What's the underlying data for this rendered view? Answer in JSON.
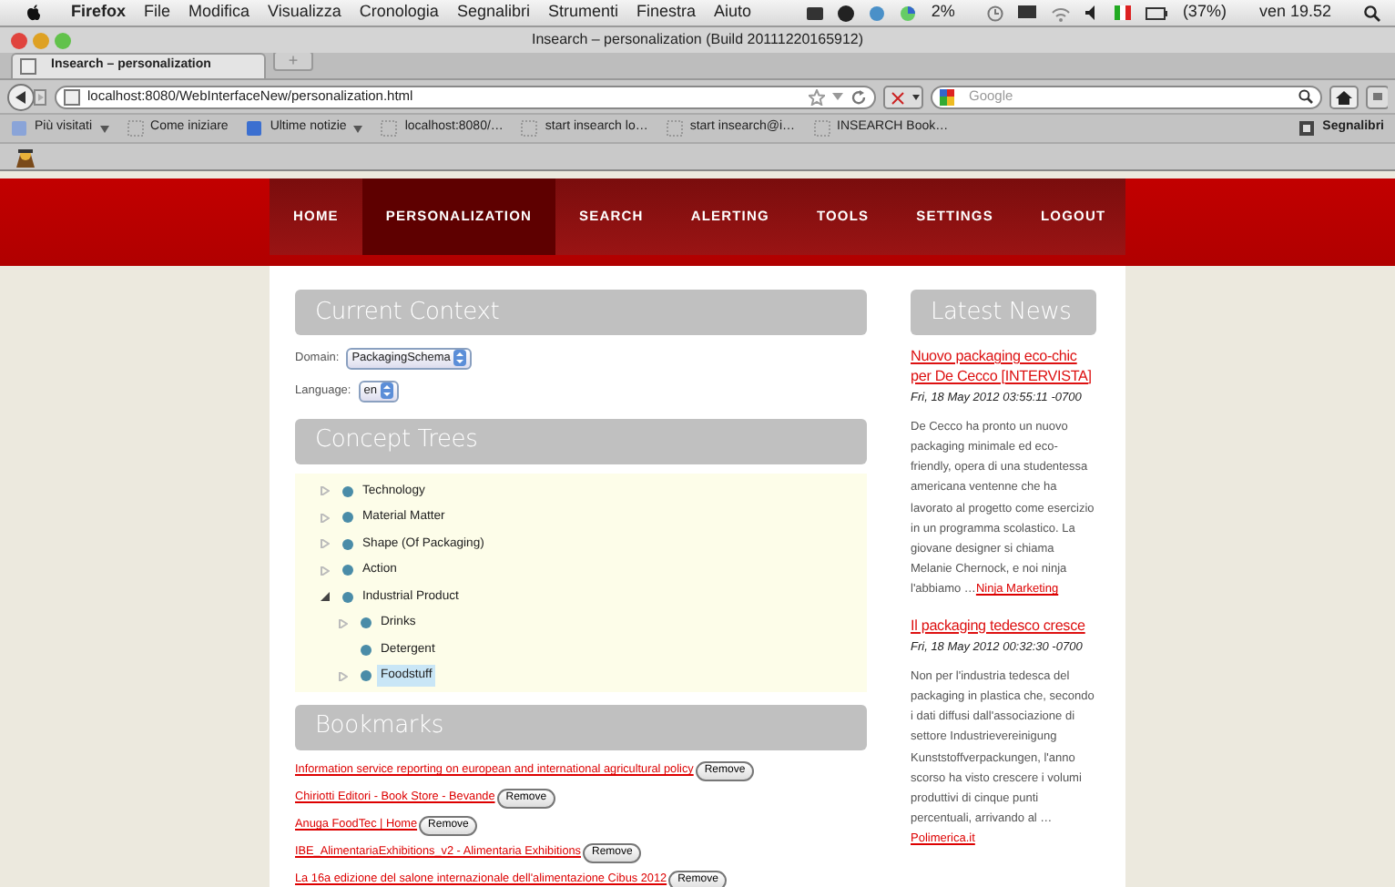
{
  "menubar": {
    "app": "Firefox",
    "menus": [
      "File",
      "Modifica",
      "Visualizza",
      "Cronologia",
      "Segnalibri",
      "Strumenti",
      "Finestra",
      "Aiuto"
    ],
    "cpu": "2%",
    "battery": "(37%)",
    "clock": "ven 19.52"
  },
  "window": {
    "title": "Insearch – personalization (Build 20111220165912)"
  },
  "tabs": [
    {
      "label": "Insearch – personalization",
      "selected": true
    }
  ],
  "new_tab": "+",
  "address": {
    "url": "localhost:8080/WebInterfaceNew/personalization.html"
  },
  "search": {
    "placeholder": "Google"
  },
  "bookmarks_bar": {
    "items": [
      {
        "label": "Più visitati",
        "kind": "menu"
      },
      {
        "label": "Come iniziare",
        "kind": "page"
      },
      {
        "label": "Ultime notizie",
        "kind": "feed"
      },
      {
        "label": "localhost:8080/…",
        "kind": "page"
      },
      {
        "label": "start insearch lo…",
        "kind": "page"
      },
      {
        "label": "start insearch@i…",
        "kind": "page"
      },
      {
        "label": "INSEARCH Book…",
        "kind": "page"
      }
    ],
    "menu": "Segnalibri"
  },
  "nav": [
    {
      "label": "HOME",
      "selected": false
    },
    {
      "label": "PERSONALIZATION",
      "selected": true
    },
    {
      "label": "SEARCH",
      "selected": false
    },
    {
      "label": "ALERTING",
      "selected": false
    },
    {
      "label": "TOOLS",
      "selected": false
    },
    {
      "label": "SETTINGS",
      "selected": false
    },
    {
      "label": "LOGOUT",
      "selected": false
    }
  ],
  "context": {
    "title": "Current Context",
    "domain_label": "Domain:",
    "domain": "PackagingSchema",
    "language_label": "Language:",
    "language": "en"
  },
  "concept_trees": {
    "title": "Concept Trees",
    "nodes": [
      {
        "label": "Technology",
        "kind": "folder",
        "expanded": false,
        "selected": false
      },
      {
        "label": "Material Matter",
        "kind": "folder",
        "expanded": false,
        "selected": false
      },
      {
        "label": "Shape (Of Packaging)",
        "kind": "folder",
        "expanded": false,
        "selected": false
      },
      {
        "label": "Action",
        "kind": "folder",
        "expanded": false,
        "selected": false
      },
      {
        "label": "Industrial Product",
        "kind": "folder",
        "expanded": true,
        "selected": false,
        "children": [
          {
            "label": "Drinks",
            "kind": "folder",
            "expanded": false,
            "selected": false
          },
          {
            "label": "Detergent",
            "kind": "leaf",
            "selected": false
          },
          {
            "label": "Foodstuff",
            "kind": "folder",
            "expanded": false,
            "selected": true
          }
        ]
      }
    ]
  },
  "bookmarks": {
    "title": "Bookmarks",
    "items": [
      {
        "title": "Information service reporting on european and international agricultural policy",
        "button": "Remove"
      },
      {
        "title": "Chiriotti Editori - Book Store - Bevande",
        "button": "Remove"
      },
      {
        "title": "Anuga FoodTec | Home",
        "button": "Remove"
      },
      {
        "title": "IBE_AlimentariaExhibitions_v2 - Alimentaria Exhibitions",
        "button": "Remove"
      },
      {
        "title": "La 16a edizione del salone internazionale dell'alimentazione Cibus 2012",
        "button": "Remove"
      }
    ]
  },
  "news": {
    "title": "Latest News",
    "items": [
      {
        "headline": "Nuovo packaging eco-chic per De Cecco [INTERVISTA]",
        "date": "Fri, 18 May 2012 03:55:11 -0700",
        "summary": "De Cecco ha pronto un nuovo packaging minimale ed eco-friendly, opera di una studentessa americana ventenne che ha lavorato al progetto come esercizio in un programma scolastico. La giovane designer si chiama Melanie Chernock, e noi ninja l'abbiamo …",
        "source": "Ninja Marketing"
      },
      {
        "headline": "Il packaging tedesco cresce",
        "date": "Fri, 18 May 2012 00:32:30 -0700",
        "summary": "Non per l'industria tedesca del packaging in plastica che, secondo i dati diffusi dall'associazione di settore Industrievereinigung Kunststoffverpackungen, l'anno scorso ha visto crescere i volumi produttivi di cinque punti percentuali, arrivando al …",
        "source": "Polimerica.it"
      }
    ]
  }
}
